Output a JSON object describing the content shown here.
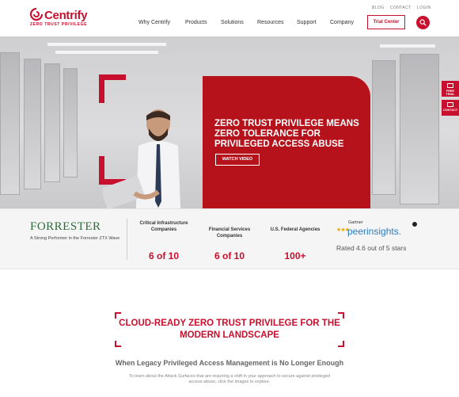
{
  "header": {
    "logo_text": "Centrify",
    "logo_tagline": "ZERO TRUST PRIVILEGE",
    "utility_links": [
      "BLOG",
      "CONTACT",
      "LOGIN"
    ],
    "nav": [
      "Why Centrify",
      "Products",
      "Solutions",
      "Resources",
      "Support",
      "Company"
    ],
    "trial_button": "Trial Center",
    "search_icon": "search-icon"
  },
  "hero": {
    "title": "ZERO TRUST PRIVILEGE MEANS ZERO TOLERANCE FOR PRIVILEGED ACCESS ABUSE",
    "cta": "WATCH VIDEO",
    "side_tabs": [
      "FREE TRIAL",
      "CONTACT"
    ]
  },
  "stats": {
    "forrester_logo": "FORRESTER",
    "forrester_note": "A Strong Performer in the Forrester ZTX Wave",
    "items": [
      {
        "label": "Critical Infrastructure Companies",
        "value": "6 of 10"
      },
      {
        "label": "Financial Services Companies",
        "value": "6 of 10"
      },
      {
        "label": "U.S. Federal Agencies",
        "value": "100+"
      }
    ],
    "gartner_label": "Gartner",
    "peer_label": "peerinsights.",
    "rating": "Rated 4.6 out of 5 stars"
  },
  "section": {
    "title": "CLOUD-READY ZERO TRUST PRIVILEGE FOR THE MODERN LANDSCAPE",
    "subtitle": "When Legacy Privileged Access Management is No Longer Enough",
    "body": "To learn about the Attack Surfaces that are requiring a shift in your approach to secure against privileged access abuse, click the images to explore."
  },
  "colors": {
    "brand_red": "#c8102e",
    "forrester_green": "#2e6b3c",
    "gartner_blue": "#2a7bc0"
  }
}
